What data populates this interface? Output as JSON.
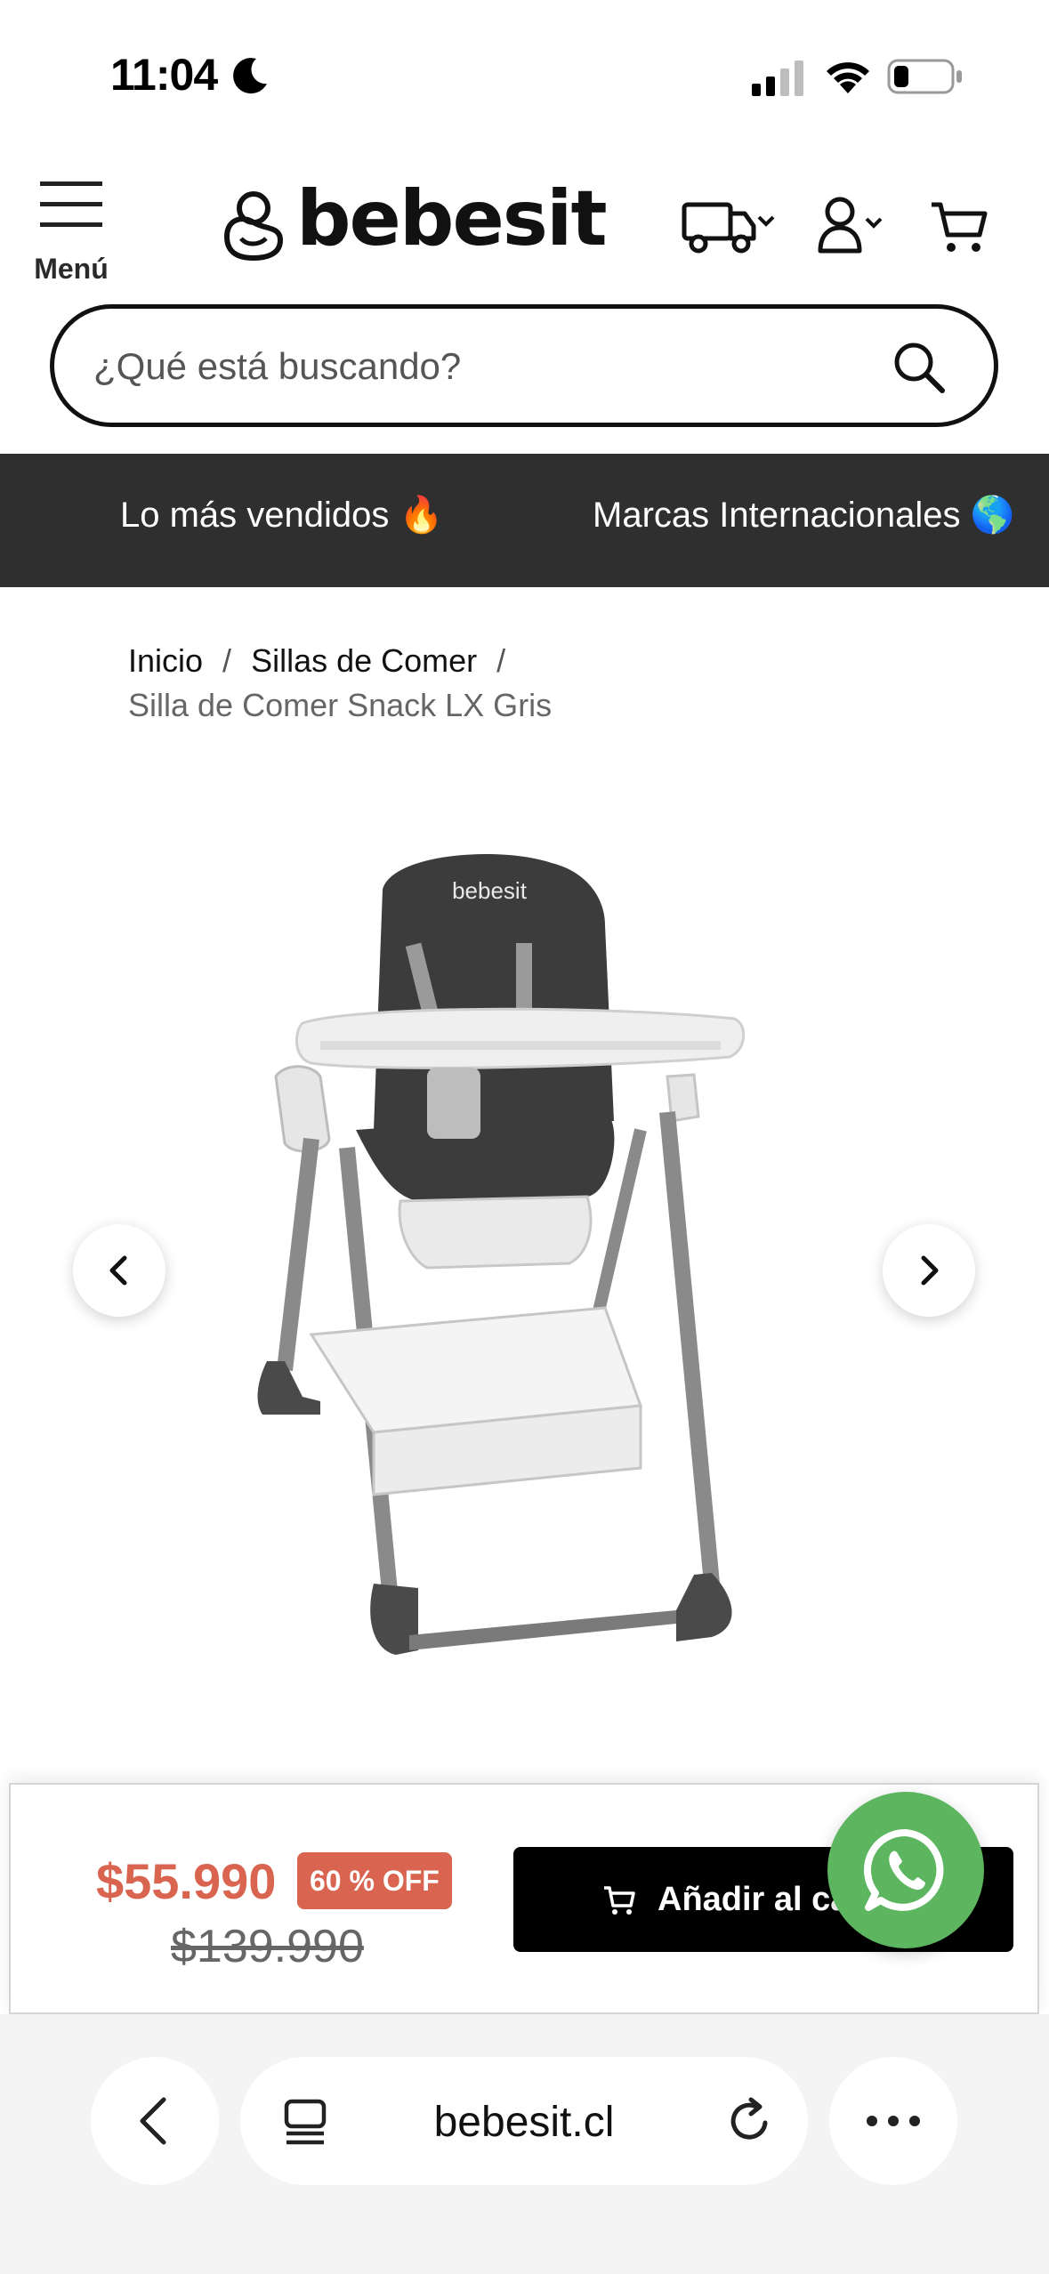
{
  "status_bar": {
    "time": "11:04"
  },
  "header": {
    "menu_label": "Menú",
    "logo_text": "bebesit"
  },
  "search": {
    "placeholder": "¿Qué está buscando?"
  },
  "nav_strip": {
    "items": [
      {
        "label": "Lo más vendidos 🔥"
      },
      {
        "label": "Marcas Internacionales 🌎"
      }
    ]
  },
  "breadcrumb": {
    "items": [
      "Inicio",
      "Sillas de Comer"
    ],
    "separator": "/",
    "current": "Silla de Comer Snack LX Gris"
  },
  "product_image": {
    "brand_on_seat": "bebesit"
  },
  "sticky_bar": {
    "price": "$55.990",
    "discount_badge": "60 % OFF",
    "old_price": "$139.990",
    "add_button_label": "Añadir al carro"
  },
  "browser": {
    "url": "bebesit.cl"
  },
  "colors": {
    "accent_price": "#d9644f",
    "nav_strip_bg": "#2f2f2f",
    "whatsapp": "#5db55f",
    "add_button_bg": "#000000"
  }
}
